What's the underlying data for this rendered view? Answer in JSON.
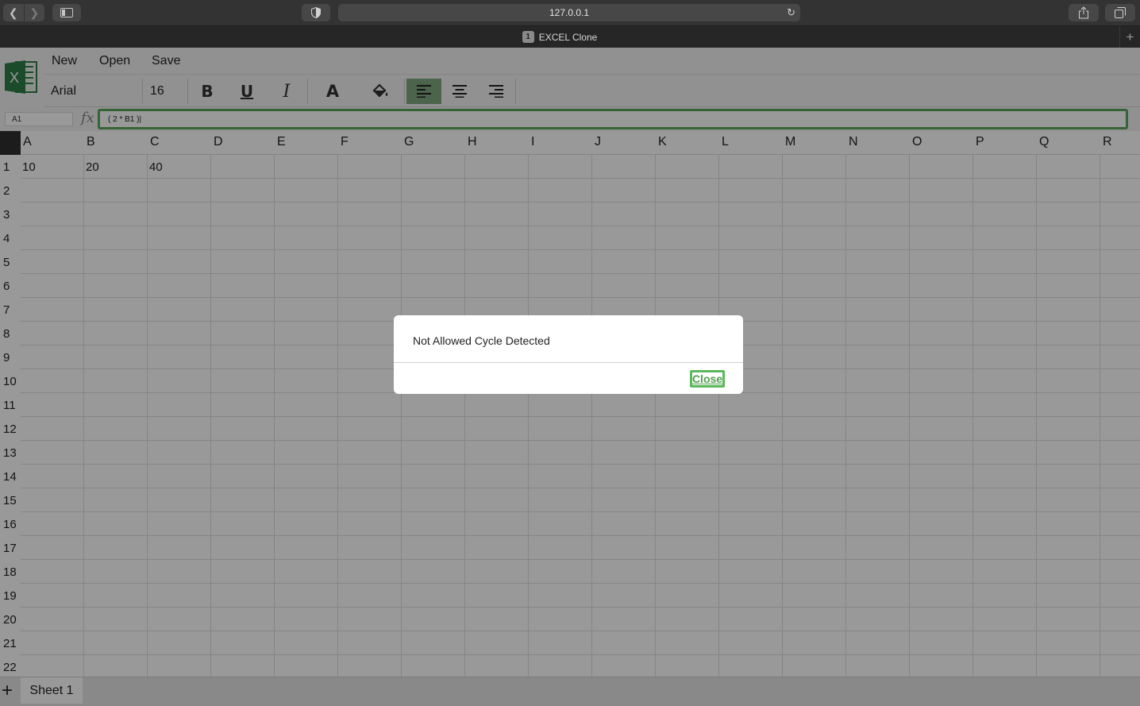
{
  "browser": {
    "url": "127.0.0.1",
    "tab_number": "1",
    "tab_title": "EXCEL Clone"
  },
  "menu": {
    "new_label": "New",
    "open_label": "Open",
    "save_label": "Save"
  },
  "format": {
    "font_family": "Arial",
    "font_size": "16",
    "alignment_selected": "left"
  },
  "formula_bar": {
    "cell_ref": "A1",
    "fx_label": "fx",
    "formula": "( 2 * B1 )|"
  },
  "grid": {
    "columns": [
      "A",
      "B",
      "C",
      "D",
      "E",
      "F",
      "G",
      "H",
      "I",
      "J",
      "K",
      "L",
      "M",
      "N",
      "O",
      "P",
      "Q",
      "R"
    ],
    "rows": [
      "1",
      "2",
      "3",
      "4",
      "5",
      "6",
      "7",
      "8",
      "9",
      "10",
      "11",
      "12",
      "13",
      "14",
      "15",
      "16",
      "17",
      "18",
      "19",
      "20",
      "21",
      "22"
    ],
    "cells": {
      "A1": "10",
      "B1": "20",
      "C1": "40"
    }
  },
  "sheets": {
    "add_label": "+",
    "tabs": [
      "Sheet 1"
    ]
  },
  "dialog": {
    "message": "Not Allowed Cycle Detected",
    "close_label": "Close"
  },
  "colors": {
    "accent": "#5cb85c",
    "active_align": "#7fa77f"
  }
}
